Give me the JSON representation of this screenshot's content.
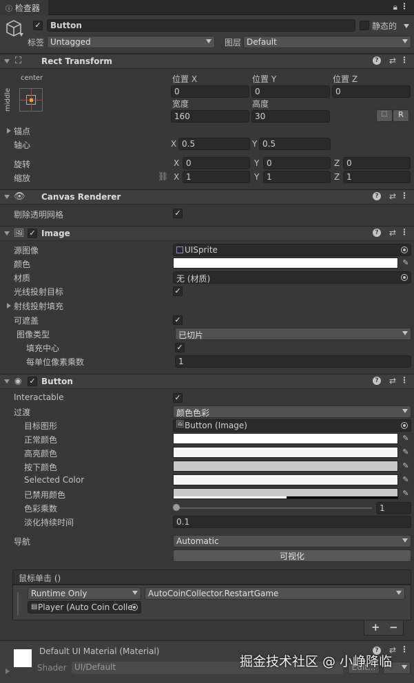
{
  "tab": {
    "title": "检查器"
  },
  "object": {
    "name": "Button",
    "static_label": "静态的",
    "tag_label": "标签",
    "tag_value": "Untagged",
    "layer_label": "图层",
    "layer_value": "Default"
  },
  "rect": {
    "title": "Rect Transform",
    "anchor_h": "center",
    "anchor_v": "middle",
    "posx_label": "位置 X",
    "posy_label": "位置 Y",
    "posz_label": "位置 Z",
    "posx": "0",
    "posy": "0",
    "posz": "0",
    "width_label": "宽度",
    "height_label": "高度",
    "width": "160",
    "height": "30",
    "r_button": "R",
    "anchors_label": "锚点",
    "pivot_label": "轴心",
    "pivot_x_label": "X",
    "pivot_x": "0.5",
    "pivot_y_label": "Y",
    "pivot_y": "0.5",
    "rotation_label": "旋转",
    "scale_label": "缩放",
    "x_label": "X",
    "y_label": "Y",
    "z_label": "Z",
    "rot_x": "0",
    "rot_y": "0",
    "rot_z": "0",
    "scale_x": "1",
    "scale_y": "1",
    "scale_z": "1"
  },
  "canvas_renderer": {
    "title": "Canvas Renderer",
    "cull_label": "剔除透明网格"
  },
  "image": {
    "title": "Image",
    "source_label": "源图像",
    "source_value": "UISprite",
    "color_label": "颜色",
    "material_label": "材质",
    "material_value": "无 (材质)",
    "raycast_label": "光线投射目标",
    "raycast_padding_label": "射线投射填充",
    "maskable_label": "可遮盖",
    "type_label": "图像类型",
    "type_value": "已切片",
    "fill_center_label": "填充中心",
    "ppu_label": "每单位像素乘数",
    "ppu_value": "1"
  },
  "button": {
    "title": "Button",
    "interactable_label": "Interactable",
    "transition_label": "过渡",
    "transition_value": "颜色色彩",
    "target_label": "目标图形",
    "target_value": "Button (Image)",
    "normal_label": "正常颜色",
    "highlight_label": "高亮颜色",
    "pressed_label": "按下颜色",
    "selected_label": "Selected Color",
    "disabled_label": "已禁用颜色",
    "multiplier_label": "色彩乘数",
    "multiplier_value": "1",
    "fade_label": "淡化持续时间",
    "fade_value": "0.1",
    "nav_label": "导航",
    "nav_value": "Automatic",
    "visualize_label": "可视化",
    "onclick_label": "鼠标单击 ()",
    "runtime_value": "Runtime Only",
    "function_value": "AutoCoinCollector.RestartGame",
    "object_value": "Player (Auto Coin Colle",
    "plus": "+",
    "minus": "−"
  },
  "material": {
    "name": "Default UI Material (Material)",
    "shader_label": "Shader",
    "shader_value": "UI/Default",
    "edit_label": "Edit..."
  },
  "watermark": "掘金技术社区 @ 小峥降临",
  "colors": {
    "normal": "#ffffff",
    "highlight": "#f5f5f5",
    "pressed": "#c8c8c8",
    "selected": "#f5f5f5",
    "disabled": "#c8c8c8"
  }
}
